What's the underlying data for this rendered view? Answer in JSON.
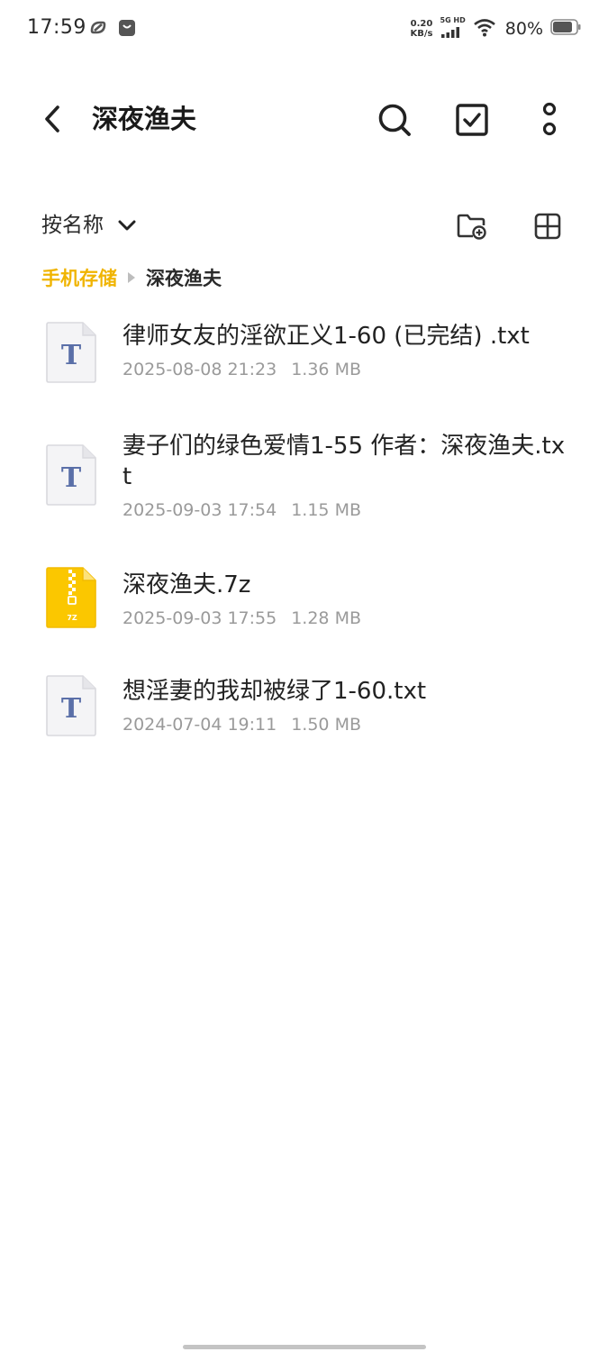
{
  "status_bar": {
    "time": "17:59",
    "net_speed_value": "0.20",
    "net_speed_unit": "KB/s",
    "signal_label": "5G HD",
    "battery": "80%"
  },
  "header": {
    "title": "深夜渔夫",
    "back_icon": "chevron-left-icon",
    "actions": [
      "search-icon",
      "checkbox-icon",
      "more-vertical-icon"
    ]
  },
  "toolbar": {
    "sort_label": "按名称",
    "view_actions": [
      "new-folder-icon",
      "grid-view-icon"
    ]
  },
  "breadcrumb": {
    "root": "手机存储",
    "current": "深夜渔夫"
  },
  "files": [
    {
      "name": "律师女友的淫欲正义1-60 (已完结) .txt",
      "date": "2025-08-08 21:23",
      "size": "1.36 MB",
      "type": "txt",
      "icon_letter": "T"
    },
    {
      "name": "妻子们的绿色爱情1-55 作者：深夜渔夫.txt",
      "date": "2025-09-03 17:54",
      "size": "1.15 MB",
      "type": "txt",
      "icon_letter": "T"
    },
    {
      "name": "深夜渔夫.7z",
      "date": "2025-09-03 17:55",
      "size": "1.28 MB",
      "type": "7z",
      "icon_letter": "7Z"
    },
    {
      "name": "想淫妻的我却被绿了1-60.txt",
      "date": "2024-07-04 19:11",
      "size": "1.50 MB",
      "type": "txt",
      "icon_letter": "T"
    }
  ],
  "colors": {
    "accent": "#f0b400",
    "text_primary": "#222222",
    "text_secondary": "#9a9a9a",
    "txt_icon_letter": "#5a6fa8",
    "archive_icon": "#fbc700"
  }
}
